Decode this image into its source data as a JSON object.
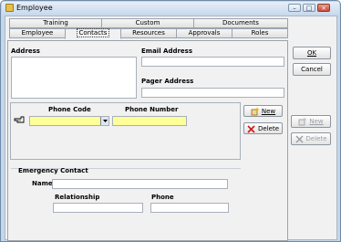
{
  "window": {
    "title": "Employee",
    "minimize": "–",
    "maximize": "□",
    "close": "×"
  },
  "tabs_back": [
    "Training",
    "Custom",
    "Documents"
  ],
  "tabs_front": [
    "Employee",
    "Contacts",
    "Resources",
    "Approvals",
    "Roles"
  ],
  "active_tab": "Contacts",
  "contacts": {
    "address_label": "Address",
    "email_label": "Email Address",
    "pager_label": "Pager Address",
    "phone_code_header": "Phone Code",
    "phone_number_header": "Phone Number",
    "new_label": "New",
    "delete_label": "Delete"
  },
  "emergency": {
    "group_label": "Emergency Contact",
    "name_label": "Name",
    "relationship_label": "Relationship",
    "phone_label": "Phone"
  },
  "side": {
    "ok_label": "OK",
    "cancel_label": "Cancel",
    "new_label": "New",
    "delete_label": "Delete"
  },
  "colors": {
    "required_field": "#ffff99",
    "frame": "#c4d6ea"
  }
}
